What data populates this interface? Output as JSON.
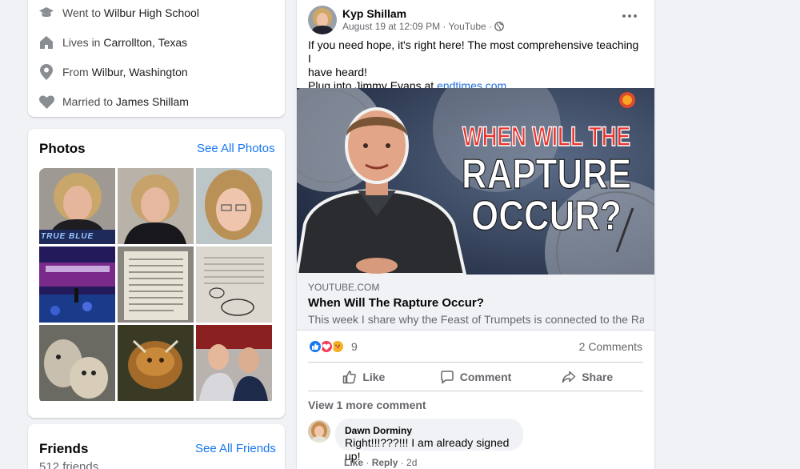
{
  "intro": {
    "school": {
      "prefix": "Went to",
      "value": "Wilbur High School"
    },
    "lives": {
      "prefix": "Lives in",
      "value": "Carrollton, Texas"
    },
    "from": {
      "prefix": "From",
      "value": "Wilbur, Washington"
    },
    "married": {
      "prefix": "Married to",
      "value": "James Shillam"
    }
  },
  "photos": {
    "title": "Photos",
    "link": "See All Photos",
    "badge_text": "TRUE BLUE"
  },
  "friends": {
    "title": "Friends",
    "link": "See All Friends",
    "count": "512 friends"
  },
  "post": {
    "author": "Kyp Shillam",
    "meta": "August 19 at 12:09 PM · YouTube ·",
    "text_line1": "If you need hope, it's right here! The most comprehensive teaching I",
    "text_line2": "have heard!",
    "text_line3_prefix": "Plug into Jimmy Evans at",
    "text_link": "endtimes.com",
    "image_headline": {
      "line1": "WHEN WILL THE",
      "line2": "RAPTURE",
      "line3": "OCCUR?"
    },
    "link_domain": "YOUTUBE.COM",
    "link_title": "When Will The Rapture Occur?",
    "link_desc": "This week I share why the Feast of Trumpets is connected to the Ra…",
    "reaction_count": "9",
    "comments_count": "2 Comments",
    "actions": {
      "like": "Like",
      "comment": "Comment",
      "share": "Share"
    },
    "view_more": "View 1 more comment",
    "comment": {
      "author": "Dawn Dorminy",
      "text": "Right!!!???!!! I am already signed up!",
      "like": "Like",
      "reply": "Reply",
      "age": "2d"
    }
  },
  "colors": {
    "accent": "#1877f2",
    "headline_red": "#e8352e"
  }
}
